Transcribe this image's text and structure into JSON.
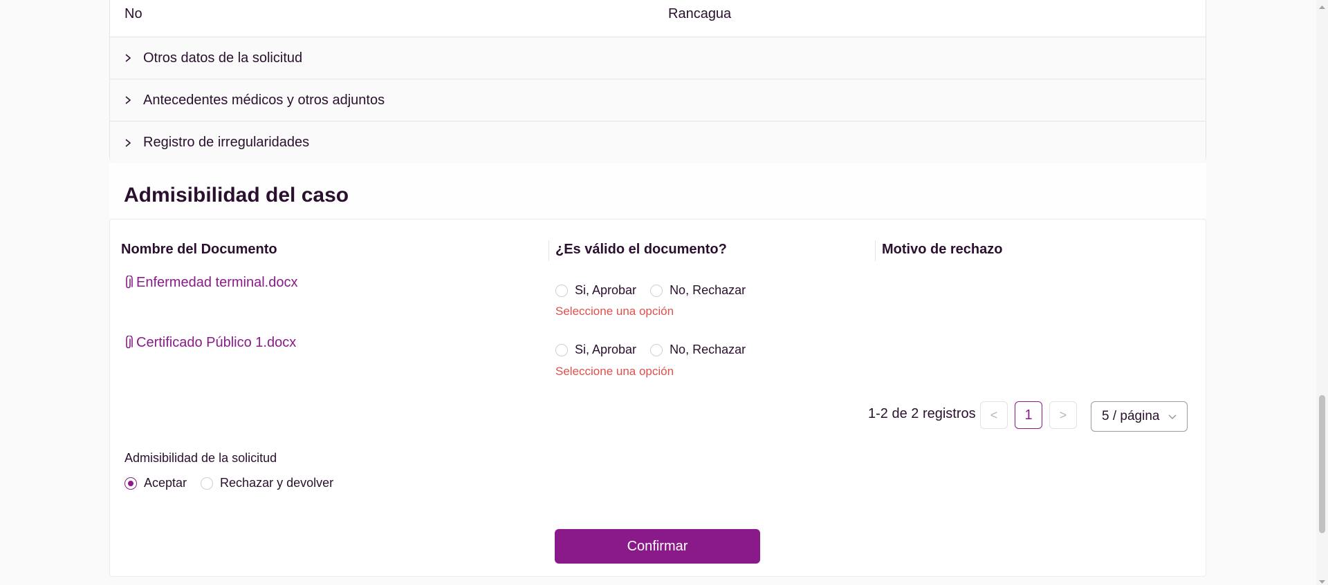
{
  "top_row": {
    "col1": "No",
    "col2": "Rancagua"
  },
  "accordion": [
    {
      "label": "Otros datos de la solicitud"
    },
    {
      "label": "Antecedentes médicos y otros adjuntos"
    },
    {
      "label": "Registro de irregularidades"
    }
  ],
  "section_title": "Admisibilidad del caso",
  "table": {
    "headers": [
      "Nombre del Documento",
      "¿Es válido el documento?",
      "Motivo de rechazo"
    ],
    "rows": [
      {
        "document": "Enfermedad terminal.docx",
        "approve": "Si, Aprobar",
        "reject": "No, Rechazar",
        "error": "Seleccione una opción"
      },
      {
        "document": "Certificado Público 1.docx",
        "approve": "Si, Aprobar",
        "reject": "No, Rechazar",
        "error": "Seleccione una opción"
      }
    ]
  },
  "pagination": {
    "total": "1-2 de 2 registros",
    "current_page": "1",
    "page_size": "5 / página",
    "prev": "<",
    "next": ">"
  },
  "admissibility": {
    "label": "Admisibilidad de la solicitud",
    "options": [
      {
        "label": "Aceptar",
        "selected": true
      },
      {
        "label": "Rechazar y devolver",
        "selected": false
      }
    ]
  },
  "confirm_label": "Confirmar",
  "colors": {
    "accent": "#8a1a8a",
    "error": "#e0504a",
    "text": "#2a0f2e"
  }
}
